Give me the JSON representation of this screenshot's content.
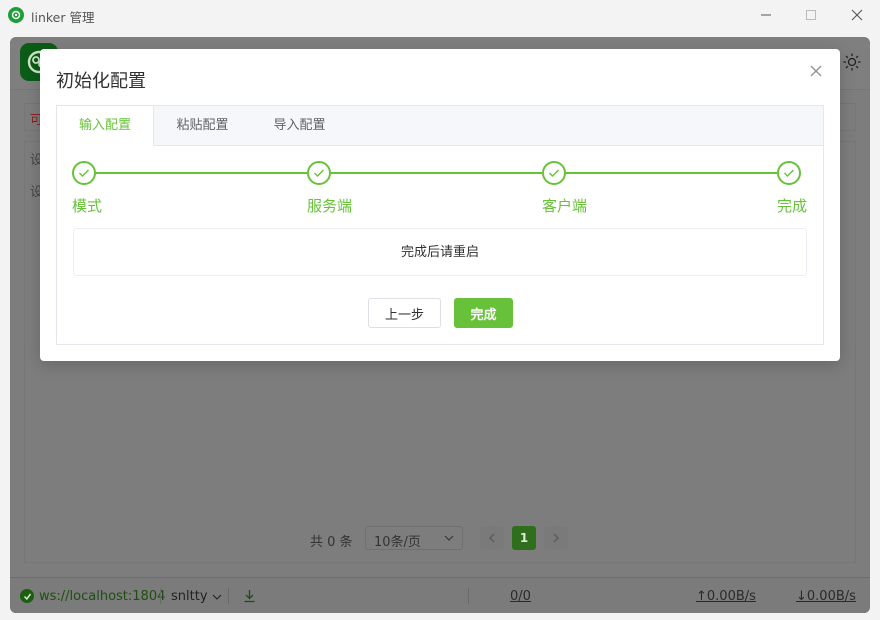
{
  "window": {
    "title": "linker 管理"
  },
  "background": {
    "side_chars": [
      "可",
      "设",
      "设"
    ],
    "pager": {
      "total": "共 0 条",
      "page_size": "10条/页",
      "current_page": "1"
    },
    "status": {
      "ws": "ws://localhost:1804",
      "user": "snltty",
      "counter": "0/0",
      "upload": "↑0.00B/s",
      "download": "↓0.00B/s"
    }
  },
  "modal": {
    "title": "初始化配置",
    "tabs": [
      {
        "label": "输入配置",
        "active": true
      },
      {
        "label": "粘贴配置",
        "active": false
      },
      {
        "label": "导入配置",
        "active": false
      }
    ],
    "steps": [
      "模式",
      "服务端",
      "客户端",
      "完成"
    ],
    "notice": "完成后请重启",
    "prev_button": "上一步",
    "done_button": "完成"
  },
  "colors": {
    "accent": "#67c23a",
    "app_green": "#1e9e3a"
  }
}
